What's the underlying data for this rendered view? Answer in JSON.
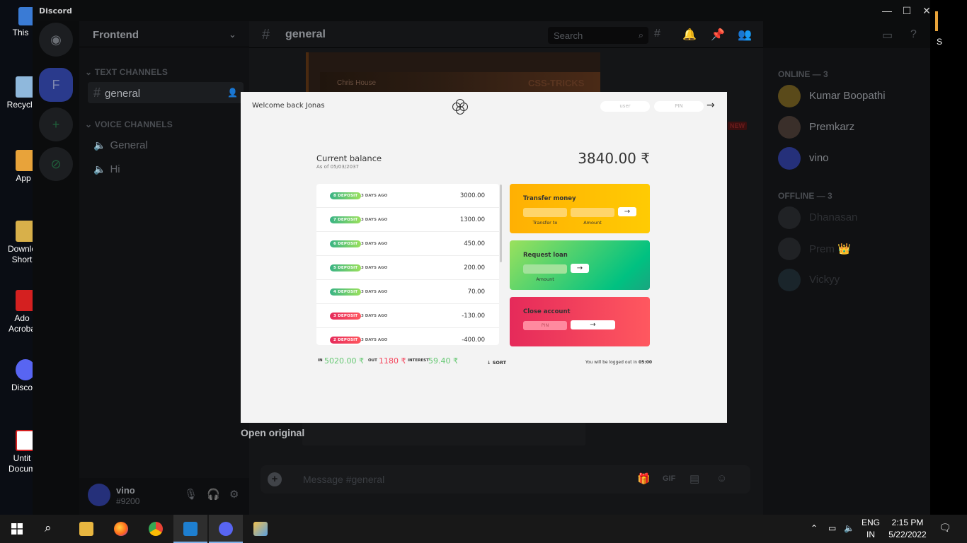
{
  "desktop": {
    "icons": [
      {
        "label": "This",
        "color": "#3a7bd5"
      },
      {
        "label": "Recycle",
        "color": "#6a9fd0"
      },
      {
        "label": "App",
        "color": "#e8a33a"
      },
      {
        "label": "Downlo\nShort",
        "color": "#d8b04a"
      },
      {
        "label": "Ado\nAcroba",
        "color": "#d42020"
      },
      {
        "label": "Disco",
        "color": "#5865f2"
      },
      {
        "label": "Untit\nDocum",
        "color": "#d42020"
      }
    ],
    "right_letter": "S"
  },
  "discord": {
    "app_name": "Discord",
    "server_name": "Frontend",
    "text_channels_label": "TEXT CHANNELS",
    "voice_channels_label": "VOICE CHANNELS",
    "text_channels": [
      "general"
    ],
    "voice_channels": [
      "General",
      "Hi"
    ],
    "guild_letter": "F",
    "current_channel": "general",
    "search_placeholder": "Search",
    "user": {
      "name": "vino",
      "tag": "#9200"
    },
    "message_placeholder": "Message #general",
    "embed_channel": "Chris House",
    "embed_brand": "CSS-TRICKS",
    "new_tag": "NEW",
    "open_original": "Open original",
    "members": {
      "online_label": "ONLINE — 3",
      "offline_label": "OFFLINE — 3",
      "online": [
        "Kumar Boopathi",
        "Premkarz",
        "vino"
      ],
      "offline": [
        "Dhanasan",
        "Prem 👑",
        "Vickyy"
      ]
    }
  },
  "bank": {
    "welcome": "Welcome back Jonas",
    "login_user_placeholder": "user",
    "login_pin_placeholder": "PIN",
    "login_arrow": "→",
    "balance_title": "Current balance",
    "balance_date": "As of 05/03/2037",
    "balance_value": "3840.00 ₹",
    "movements": [
      {
        "type": "8 DEPOSIT",
        "kind": "dep",
        "date": "3 DAYS AGO",
        "value": "3000.00"
      },
      {
        "type": "7 DEPOSIT",
        "kind": "dep",
        "date": "3 DAYS AGO",
        "value": "1300.00"
      },
      {
        "type": "6 DEPOSIT",
        "kind": "dep",
        "date": "3 DAYS AGO",
        "value": "450.00"
      },
      {
        "type": "5 DEPOSIT",
        "kind": "dep",
        "date": "3 DAYS AGO",
        "value": "200.00"
      },
      {
        "type": "4 DEPOSIT",
        "kind": "dep",
        "date": "3 DAYS AGO",
        "value": "70.00"
      },
      {
        "type": "3 DEPOSIT",
        "kind": "wd",
        "date": "3 DAYS AGO",
        "value": "-130.00"
      },
      {
        "type": "2 DEPOSIT",
        "kind": "wd",
        "date": "3 DAYS AGO",
        "value": "-400.00"
      }
    ],
    "transfer": {
      "title": "Transfer money",
      "to_label": "Transfer to",
      "amount_label": "Amount",
      "button": "→"
    },
    "loan": {
      "title": "Request loan",
      "amount_label": "Amount",
      "button": "→"
    },
    "close": {
      "title": "Close account",
      "pin_placeholder": "PIN",
      "button": "→"
    },
    "summary": {
      "in_label": "IN",
      "in_value": "5020.00 ₹",
      "out_label": "OUT",
      "out_value": "1180 ₹",
      "interest_label": "INTEREST",
      "interest_value": "59.40 ₹"
    },
    "sort_label": "↓ SORT",
    "timer_text": "You will be logged out in ",
    "timer_value": "05:00"
  },
  "taskbar": {
    "lang_line1": "ENG",
    "lang_line2": "IN",
    "time": "2:15 PM",
    "date": "5/22/2022"
  }
}
